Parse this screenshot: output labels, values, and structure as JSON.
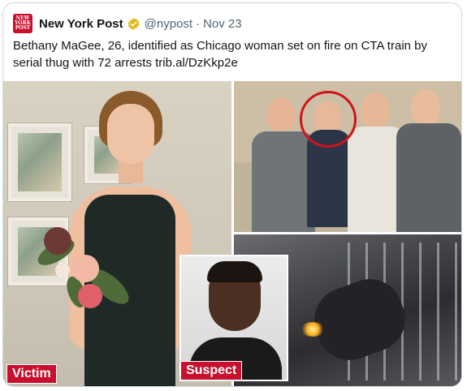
{
  "tweet": {
    "avatar": {
      "line1": "NEW",
      "line2": "YORK",
      "line3": "POST"
    },
    "author_name": "New York Post",
    "handle": "@nypost",
    "separator": "·",
    "date": "Nov 23",
    "text": "Bethany MaGee, 26, identified as Chicago woman set on fire on CTA train by serial thug with 72 arrests ",
    "link": "trib.al/DzKkp2e"
  },
  "media": {
    "victim_label": "Victim",
    "suspect_label": "Suspect"
  },
  "colors": {
    "brand_red": "#c8102e",
    "verified_gold": "#e2b719",
    "circle_red": "#d0121b",
    "secondary_text": "#536471"
  },
  "icons": {
    "verified": "verified-badge-icon"
  }
}
